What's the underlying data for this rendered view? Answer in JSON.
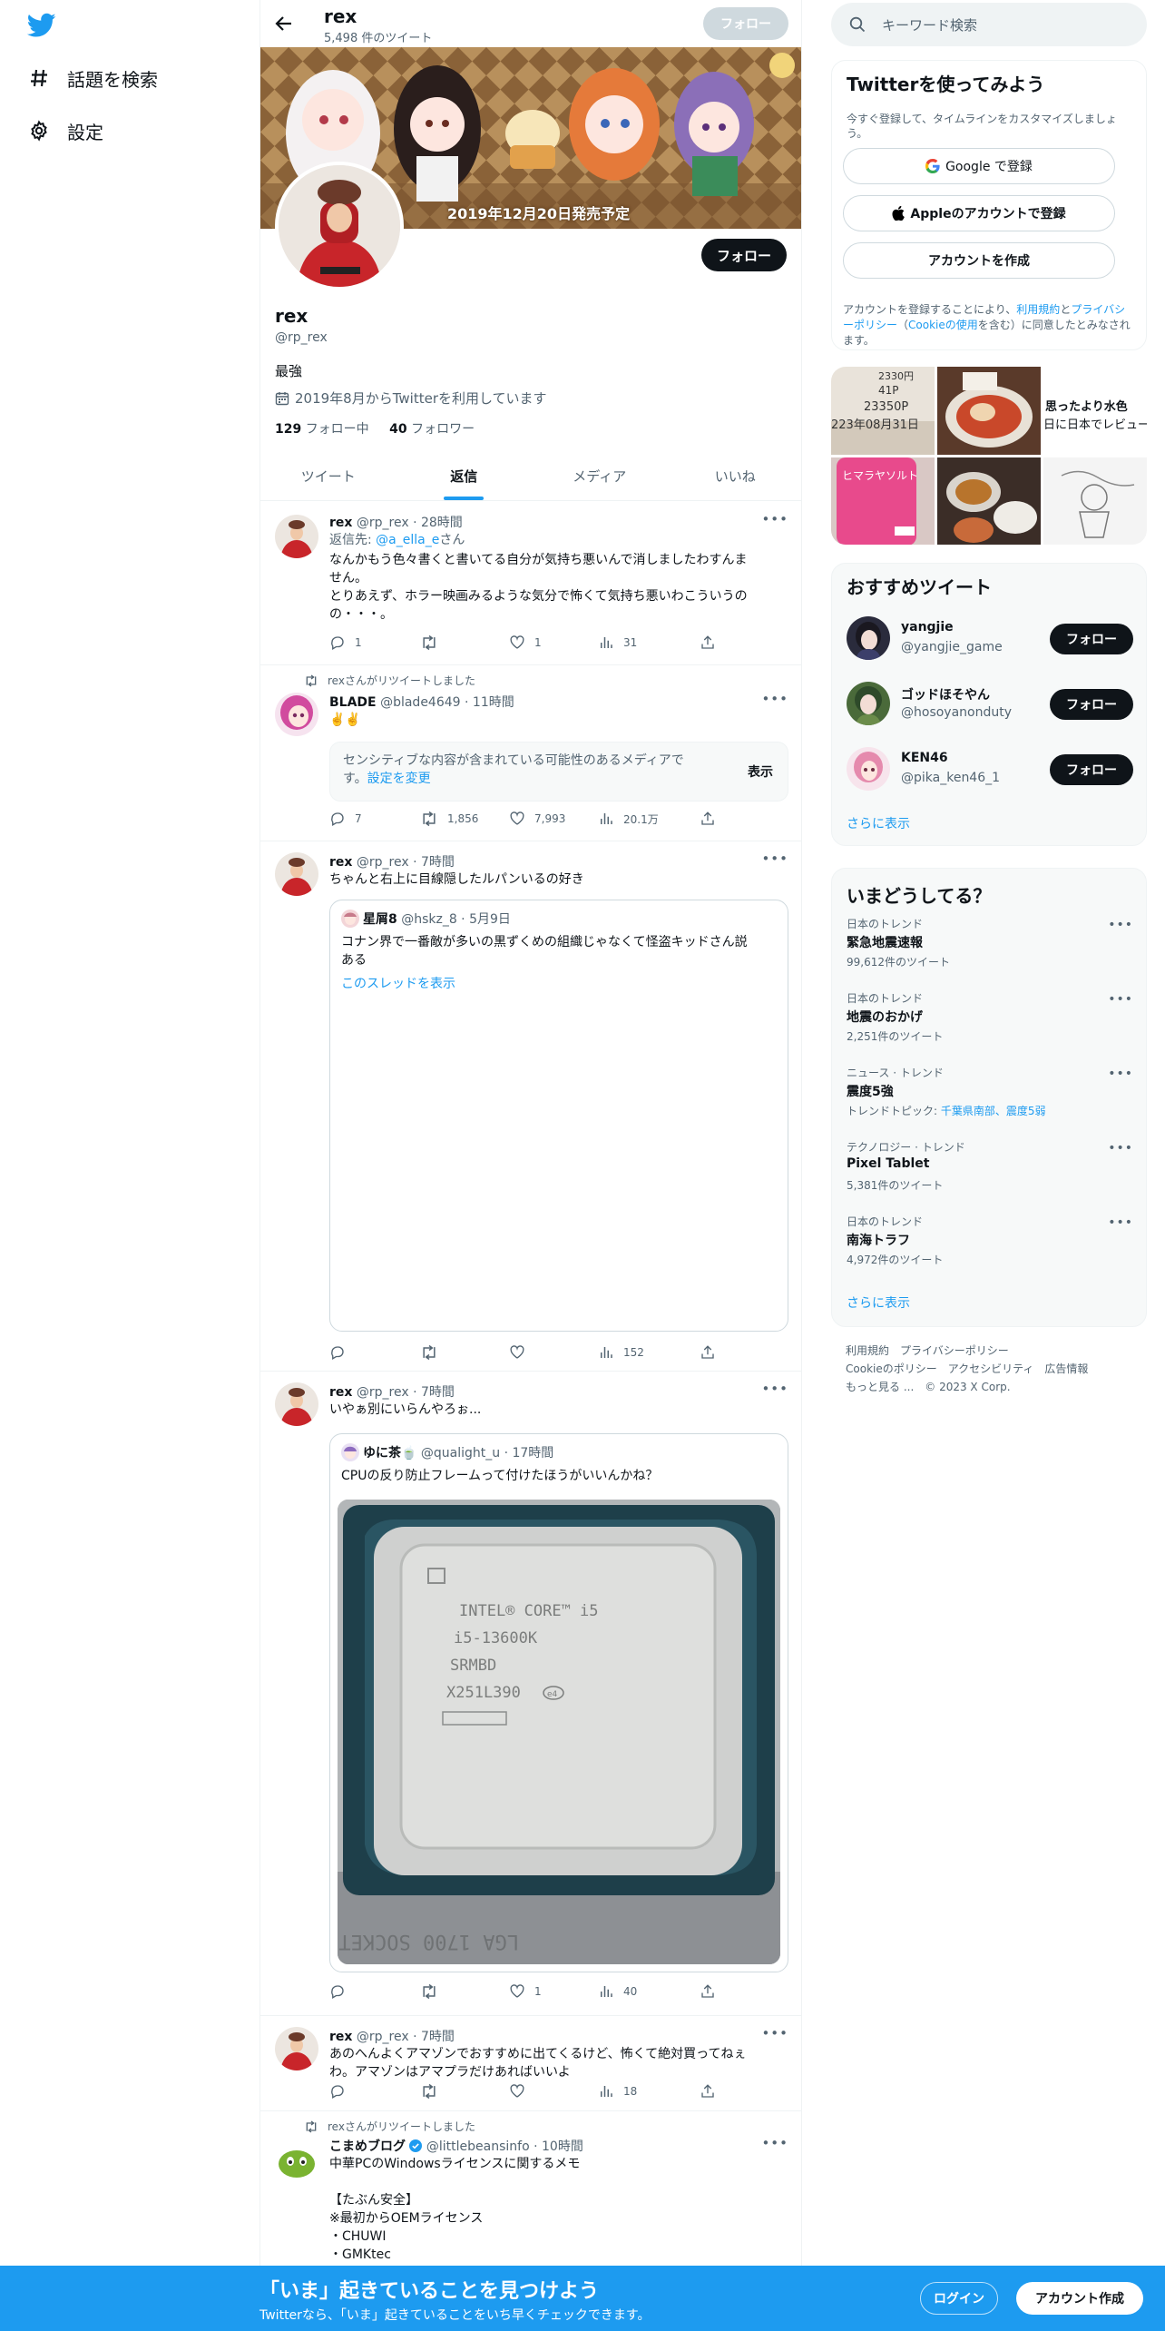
{
  "nav": {
    "explore_label": "話題を検索",
    "settings_label": "設定"
  },
  "profile": {
    "top_name": "rex",
    "tweet_count": "5,498 件のツイート",
    "top_follow": "フォロー",
    "banner_caption": "2019年12月20日発売予定",
    "follow_label": "フォロー",
    "name": "rex",
    "handle": "@rp_rex",
    "bio": "最強",
    "joined": "2019年8月からTwitterを利用しています",
    "following_count": "129",
    "following_label": "フォロー中",
    "followers_count": "40",
    "followers_label": "フォロワー"
  },
  "tabs": [
    {
      "label": "ツイート",
      "active": false
    },
    {
      "label": "返信",
      "active": true
    },
    {
      "label": "メディア",
      "active": false
    },
    {
      "label": "いいね",
      "active": false
    }
  ],
  "tweets": [
    {
      "name": "rex",
      "handle": "@rp_rex · 28時間",
      "reply_prefix": "返信先: ",
      "reply_to": "@a_ella_e",
      "reply_suffix": "さん",
      "text_lines": [
        "なんかもう色々書くと書いてる自分が気持ち悪いんで消しましたわすんま",
        "せん。",
        "とりあえず、ホラー映画みるような気分で怖くて気持ち悪いわこういうの",
        "の・・・。"
      ],
      "replies": "1",
      "retweets": "",
      "likes": "1",
      "views": "31"
    },
    {
      "retweeted_by": "rexさんがリツイートしました",
      "name": "BLADE",
      "handle": "@blade4649 · 11時間",
      "text": "✌️✌️",
      "sensitive_text_line1": "センシティブな内容が含まれている可能性のあるメディアで",
      "sensitive_text_line2": "す。",
      "sensitive_link": "設定を変更",
      "sensitive_show": "表示",
      "replies": "7",
      "retweets": "1,856",
      "likes": "7,993",
      "views": "20.1万"
    },
    {
      "name": "rex",
      "handle": "@rp_rex · 7時間",
      "text": "ちゃんと右上に目線隠したルパンいるの好き",
      "quote": {
        "name": "星屑8",
        "handle": "@hskz_8 · 5月9日",
        "text_line1": "コナン界で一番敵が多いの黒ずくめの組織じゃなくて怪盗キッドさん説",
        "text_line2": "ある",
        "thread_link": "このスレッドを表示"
      },
      "replies": "",
      "retweets": "",
      "likes": "",
      "views": "152"
    },
    {
      "name": "rex",
      "handle": "@rp_rex · 7時間",
      "text": "いやぁ別にいらんやろぉ...",
      "quote": {
        "name": "ゆに茶🍵",
        "handle": "@qualight_u · 17時間",
        "text": "CPUの反り防止フレームって付けたほうがいいんかね？",
        "cpu_line1": "INTEL® CORE™ i5",
        "cpu_line2": "i5-13600K",
        "cpu_line3": "SRMBD",
        "cpu_line4": "X251L390",
        "cpu_mark": "e4",
        "cpu_mirror": "LGA 1700 SOCKET"
      },
      "replies": "",
      "retweets": "",
      "likes": "1",
      "views": "40"
    },
    {
      "name": "rex",
      "handle": "@rp_rex · 7時間",
      "text_line1": "あのへんよくアマゾンでおすすめに出てくるけど、怖くて絶対買ってねぇ",
      "text_line2": "わ。アマゾンはアマプラだけあればいいよ",
      "replies": "",
      "retweets": "",
      "likes": "",
      "views": "18"
    },
    {
      "retweeted_by": "rexさんがリツイートしました",
      "name": "こまめブログ",
      "handle": "@littlebeansinfo · 10時間",
      "text_lines": [
        "中華PCのWindowsライセンスに関するメモ",
        "",
        "【たぶん安全】",
        "※最初からOEMライセンス",
        "・CHUWI",
        "・GMKtec"
      ]
    }
  ],
  "sidebar": {
    "search_placeholder": "キーワード検索",
    "signup": {
      "title": "Twitterを使ってみよう",
      "subtitle": "今すぐ登録して、タイムラインをカスタマイズしましょう。",
      "google": "Google で登録",
      "apple": "Appleのアカウントで登録",
      "create": "アカウントを作成",
      "legal_1": "アカウントを登録することにより、",
      "legal_terms": "利用規約",
      "legal_2": "と",
      "legal_privacy": "プライバシーポリシー",
      "legal_3": "（",
      "legal_cookie": "Cookieの使用",
      "legal_4": "を含む）に同意したとみなされます。"
    },
    "media_texts": {
      "m1a": "2330円",
      "m1b": "41P",
      "m1c": "23350P",
      "m1d": "223年08月31日",
      "m3a": "思ったより水色",
      "m3b": "日に日本でレビュー",
      "m4": "ヒマラヤソルト"
    },
    "who_to_follow": {
      "title": "おすすめツイート",
      "users": [
        {
          "name": "yangjie",
          "handle": "@yangjie_game",
          "button": "フォロー"
        },
        {
          "name": "ゴッドほそやん",
          "handle": "@hosoyanonduty",
          "button": "フォロー"
        },
        {
          "name": "KEN46",
          "handle": "@pika_ken46_1",
          "button": "フォロー"
        }
      ],
      "more": "さらに表示"
    },
    "trends": {
      "title": "いまどうしてる？",
      "items": [
        {
          "category": "日本のトレンド",
          "name": "緊急地震速報",
          "meta": "99,612件のツイート"
        },
        {
          "category": "日本のトレンド",
          "name": "地震のおかげ",
          "meta": "2,251件のツイート"
        },
        {
          "category": "ニュース · トレンド",
          "name": "震度5強",
          "meta": "トレンドトピック: ",
          "meta_links": "千葉県南部、震度5弱"
        },
        {
          "category": "テクノロジー · トレンド",
          "name": "Pixel Tablet",
          "meta": "5,381件のツイート"
        },
        {
          "category": "日本のトレンド",
          "name": "南海トラフ",
          "meta": "4,972件のツイート"
        }
      ],
      "more": "さらに表示"
    },
    "footer": {
      "terms": "利用規約",
      "privacy": "プライバシーポリシー",
      "cookie": "Cookieのポリシー",
      "accessibility": "アクセシビリティ",
      "ads": "広告情報",
      "more": "もっと見る ...",
      "copyright": "© 2023 X Corp."
    }
  },
  "bottom_bar": {
    "title": "「いま」起きていることを見つけよう",
    "subtitle": "Twitterなら、「いま」起きていることをいち早くチェックできます。",
    "login": "ログイン",
    "signup": "アカウント作成"
  },
  "colors": {
    "accent": "#1d9bf0",
    "text": "#0f1419",
    "secondary": "#536471"
  }
}
